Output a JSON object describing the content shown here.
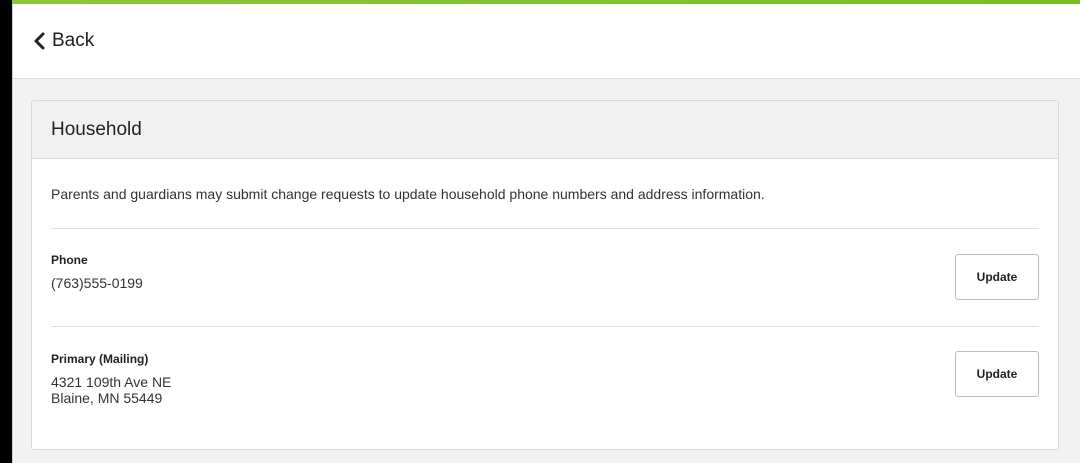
{
  "header": {
    "back_label": "Back"
  },
  "card": {
    "title": "Household",
    "intro": "Parents and guardians may submit change requests to update household phone numbers and address information."
  },
  "phone": {
    "label": "Phone",
    "value": "(763)555-0199",
    "button_label": "Update"
  },
  "address": {
    "label": "Primary (Mailing)",
    "line1": "4321 109th Ave NE",
    "line2": "Blaine, MN 55449",
    "button_label": "Update"
  },
  "icons": {
    "back": "chevron-left-icon"
  },
  "colors": {
    "accent": "#78be20",
    "text": "#212121",
    "card_header_bg": "#f2f2f2"
  }
}
